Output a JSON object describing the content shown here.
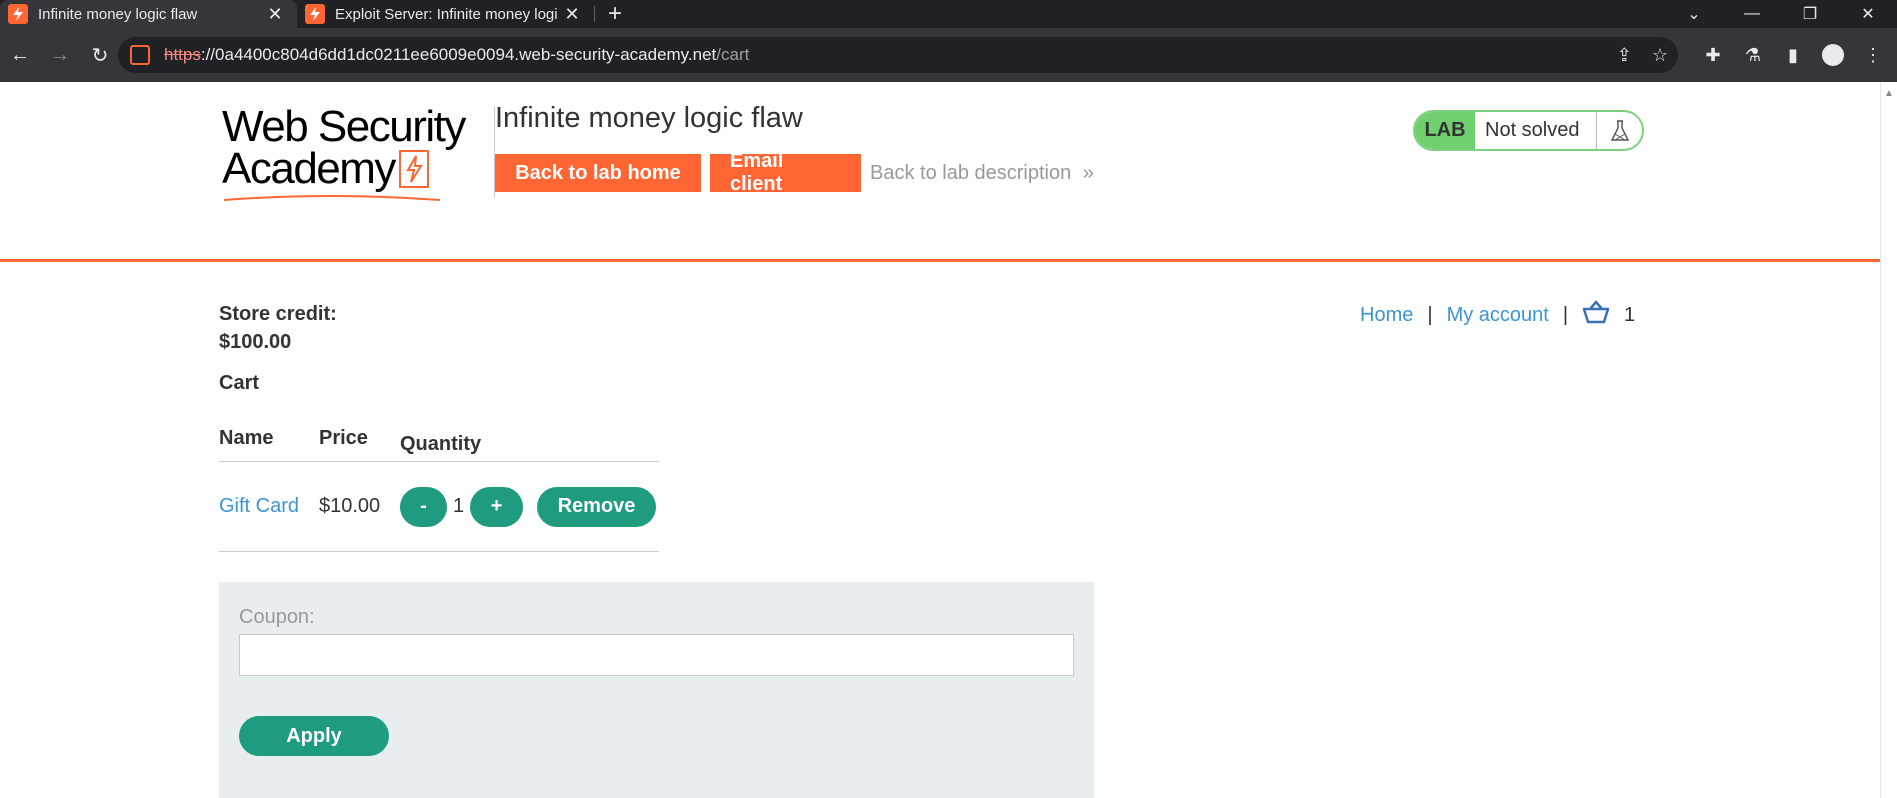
{
  "browser": {
    "tabs": [
      {
        "title": "Infinite money logic flaw",
        "active": true
      },
      {
        "title": "Exploit Server: Infinite money logi",
        "active": false
      }
    ],
    "url_scheme": "https",
    "url_host": "://0a4400c804d6dd1dc0211ee6009e0094.web-security-academy.net",
    "url_path": "/cart"
  },
  "header": {
    "logo_line1": "Web Security",
    "logo_line2": "Academy",
    "lab_title": "Infinite money logic flaw",
    "back_to_lab_home": "Back to lab home",
    "email_client": "Email client",
    "back_to_description": "Back to lab description",
    "lab_badge": "LAB",
    "lab_status": "Not solved"
  },
  "nav": {
    "home": "Home",
    "my_account": "My account",
    "cart_count": "1",
    "separator": "|"
  },
  "store_credit": {
    "label": "Store credit:",
    "value": "$100.00"
  },
  "cart": {
    "heading": "Cart",
    "columns": {
      "name": "Name",
      "price": "Price",
      "quantity": "Quantity"
    },
    "items": [
      {
        "name": "Gift Card",
        "price": "$10.00",
        "quantity": "1",
        "minus": "-",
        "plus": "+",
        "remove": "Remove"
      }
    ]
  },
  "coupon": {
    "label": "Coupon:",
    "value": "",
    "apply": "Apply"
  },
  "colors": {
    "brand_orange": "#ff6633",
    "action_green": "#1f9b7f",
    "link_blue": "#3b95d9"
  }
}
